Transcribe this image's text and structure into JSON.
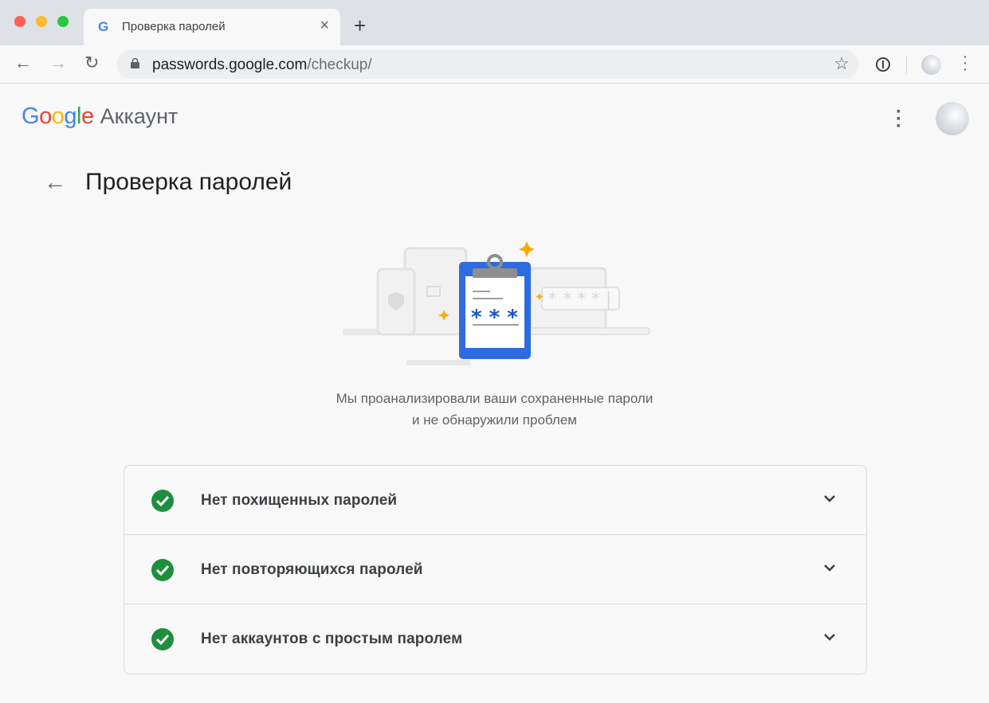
{
  "browser": {
    "tab_title": "Проверка паролей",
    "url_host": "passwords.google.com",
    "url_path": "/checkup/"
  },
  "header": {
    "logo": "Google",
    "product": "Аккаунт"
  },
  "page": {
    "title": "Проверка паролей",
    "message_line1": "Мы проанализировали ваши сохраненные пароли",
    "message_line2": "и не обнаружили проблем"
  },
  "illustration": {
    "masked": "* * *"
  },
  "checks": [
    {
      "label": "Нет похищенных паролей"
    },
    {
      "label": "Нет повторяющихся паролей"
    },
    {
      "label": "Нет аккаунтов с простым паролем"
    }
  ]
}
